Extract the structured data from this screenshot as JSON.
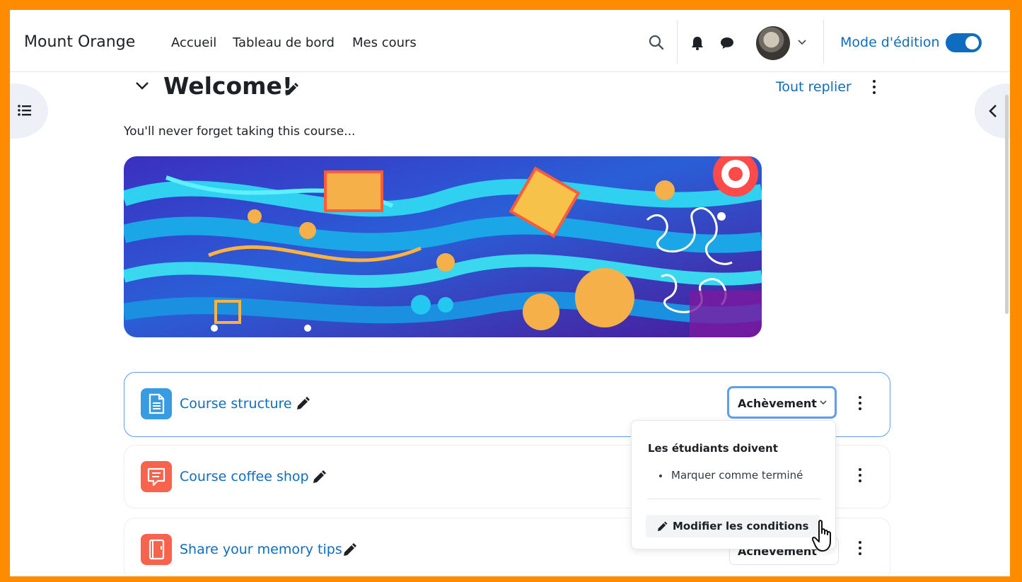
{
  "navbar": {
    "brand": "Mount Orange",
    "links": [
      "Accueil",
      "Tableau de bord",
      "Mes cours"
    ],
    "edit_mode_label": "Mode d'édition",
    "edit_mode_on": true
  },
  "section": {
    "title": "Welcome!",
    "collapse_all": "Tout replier",
    "summary": "You'll never forget taking this course..."
  },
  "activities": [
    {
      "name": "Course structure",
      "icon": "page-icon",
      "icon_color": "#399be2",
      "completion_label": "Achèvement",
      "selected": true
    },
    {
      "name": "Course coffee shop",
      "icon": "forum-icon",
      "icon_color": "#f7634d"
    },
    {
      "name": "Share your memory tips",
      "icon": "book-icon",
      "icon_color": "#f7634d",
      "completion_label": "Achèvement"
    }
  ],
  "completion_dropdown": {
    "header": "Les étudiants doivent",
    "conditions": [
      "Marquer comme terminé"
    ],
    "edit_action": "Modifier les conditions"
  },
  "colors": {
    "frame_border": "#ff8c00",
    "link": "#0f6cbf",
    "accent_blue": "#5e9df0"
  }
}
